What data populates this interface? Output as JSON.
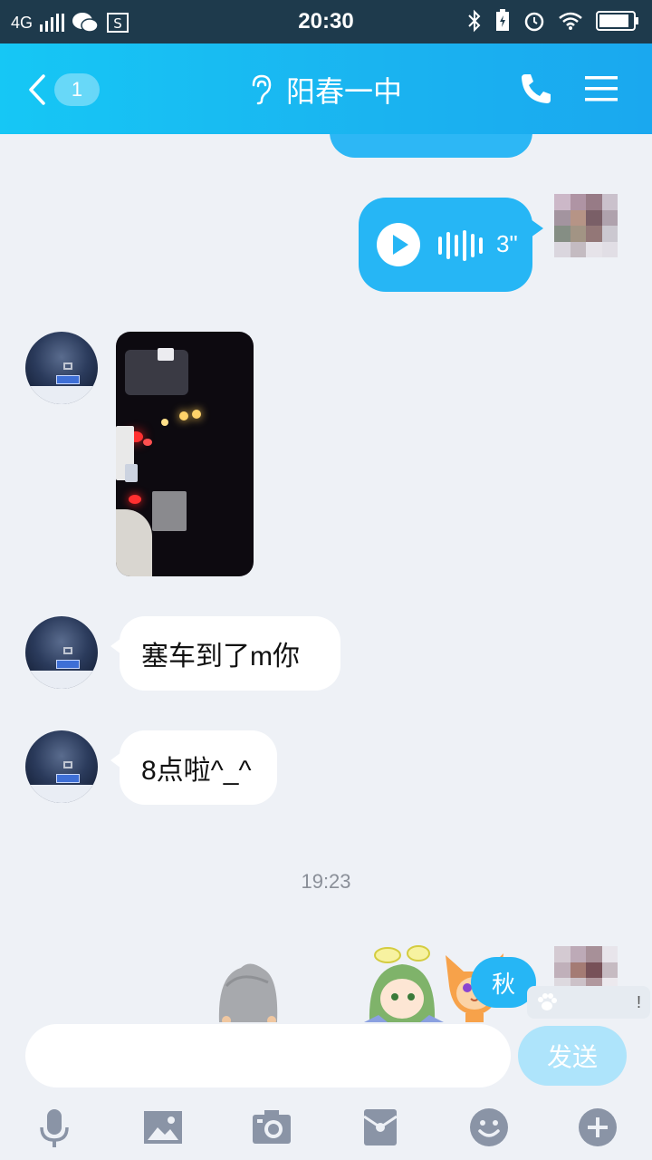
{
  "status": {
    "network": "4G",
    "time": "20:30",
    "icons": [
      "wechat-icon",
      "sim-icon",
      "bluetooth-icon",
      "battery-charging-icon",
      "alarm-icon",
      "wifi-icon",
      "battery-icon"
    ]
  },
  "header": {
    "unread_count": "1",
    "title": "阳春一中",
    "icons": [
      "back-arrow-icon",
      "earpiece-icon",
      "phone-icon",
      "menu-icon"
    ]
  },
  "messages": {
    "voice_duration": "3\"",
    "text1": "塞车到了m你",
    "text2": "8点啦^_^",
    "timestamp": "19:23",
    "partial_bubble": "秋"
  },
  "input": {
    "value": "",
    "send_label": "发送",
    "note_partial": "!"
  },
  "toolbar": {
    "icons": [
      "microphone-icon",
      "image-icon",
      "camera-icon",
      "red-packet-icon",
      "emoji-icon",
      "plus-icon"
    ]
  },
  "colors": {
    "accent": "#1ab3f0",
    "status_bar": "#1e3a4c",
    "background": "#eef1f6",
    "bubble_self": "#26b6f5",
    "bubble_other": "#ffffff"
  }
}
